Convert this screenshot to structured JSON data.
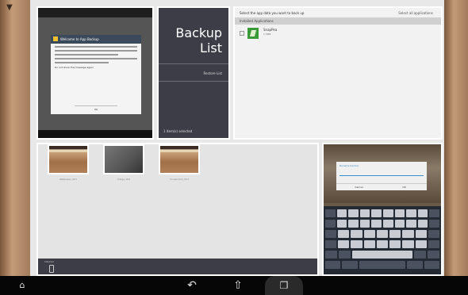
{
  "backup_panel": {
    "title_line1": "Backup",
    "title_line2": "List",
    "restore_label": "Restore List",
    "status_text": "1 item(s) selected"
  },
  "app_select_panel": {
    "heading": "Select the app data you want to back up",
    "select_all_label": "Select all applications",
    "section_label": "Installed Applications",
    "apps": [
      {
        "name": "SnapPea",
        "size": "1.5MB"
      }
    ]
  },
  "dialog_panel": {
    "dialog_title": "Welcome to App Backup",
    "checkbox_label": "Do not show this message again",
    "ok_label": "OK"
  },
  "gallery_panel": {
    "thumbnails": [
      {
        "caption": "Wallpaper_001"
      },
      {
        "caption": "Image_002"
      },
      {
        "caption": "Screenshot_003"
      }
    ],
    "footer_label": "Internal"
  },
  "keyboard_panel": {
    "dialog_title": "Rename backup",
    "cancel_label": "Cancel",
    "ok_label": "OK"
  },
  "nav_icons": [
    "home-icon",
    "back-icon",
    "home-button-icon",
    "recent-apps-icon"
  ]
}
